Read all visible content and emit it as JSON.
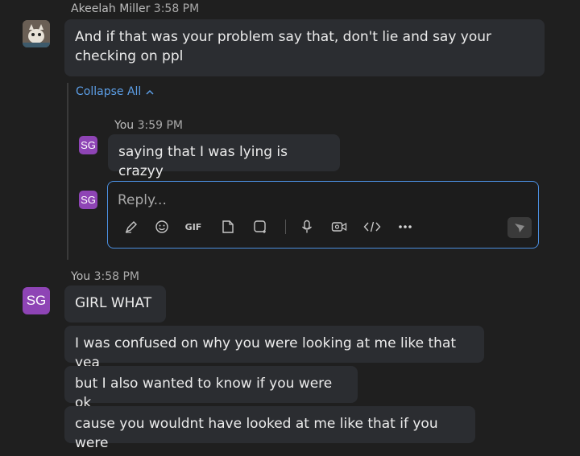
{
  "msg1": {
    "author": "Akeelah Miller",
    "time": "3:58 PM",
    "text_line1": "And if that was your problem say that, don't lie and say your",
    "text_line2": "checking on ppl"
  },
  "thread": {
    "collapse_label": "Collapse All",
    "reply": {
      "author": "You",
      "time": "3:59 PM",
      "avatar_initials": "SG",
      "text": "saying that I was lying is crazyy"
    },
    "composer": {
      "avatar_initials": "SG",
      "placeholder": "Reply...",
      "gif_label": "GIF"
    }
  },
  "msg2": {
    "author": "You",
    "time": "3:58 PM",
    "avatar_initials": "SG",
    "bubbles": [
      "GIRL WHAT",
      "I was confused on why you were looking at me like that yea",
      "but I also wanted to know if you were ok",
      "cause you wouldnt have looked at me like that if you were"
    ]
  },
  "colors": {
    "background": "#1f1f1f",
    "bubble": "#2b2d31",
    "accent_blue": "#4b8fe0",
    "avatar_purple": "#8e44b5"
  }
}
